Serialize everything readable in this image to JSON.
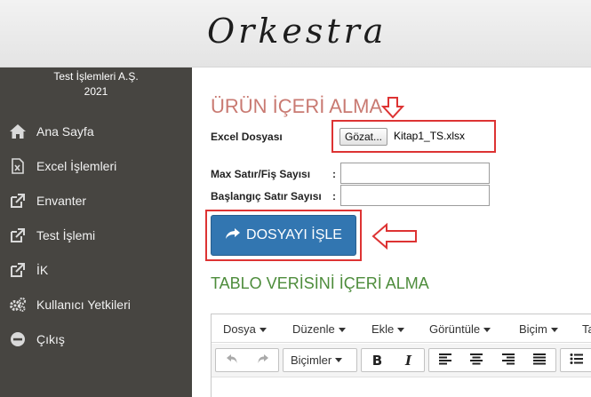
{
  "header": {
    "brand": "Orkestra"
  },
  "sidebar": {
    "company": "Test İşlemleri A.Ş.",
    "year": "2021",
    "items": [
      {
        "label": "Ana Sayfa",
        "icon": "home-icon"
      },
      {
        "label": "Excel İşlemleri",
        "icon": "excel-file-icon"
      },
      {
        "label": "Envanter",
        "icon": "external-link-icon"
      },
      {
        "label": "Test İşlemi",
        "icon": "external-link-icon"
      },
      {
        "label": "İK",
        "icon": "external-link-icon"
      },
      {
        "label": "Kullanıcı Yetkileri",
        "icon": "gears-icon"
      },
      {
        "label": "Çıkış",
        "icon": "minus-circle-icon"
      }
    ]
  },
  "main": {
    "title": "ÜRÜN İÇERİ ALMA",
    "excel_label": "Excel Dosyası",
    "browse_label": "Gözat...",
    "file_name": "Kitap1_TS.xlsx",
    "max_rows_label": "Max Satır/Fiş Sayısı",
    "start_row_label": "Başlangıç Satır Sayısı",
    "colon": ":",
    "max_rows_value": "",
    "start_row_value": "",
    "process_button": "DOSYAYI İŞLE",
    "table_section_title": "TABLO VERİSİNİ İÇERİ ALMA"
  },
  "editor": {
    "menus": [
      "Dosya",
      "Düzenle",
      "Ekle",
      "Görüntüle",
      "Biçim",
      "Ta"
    ],
    "format_select": "Biçimler"
  },
  "colors": {
    "sidebar_bg": "#474541",
    "title_color": "#c97a72",
    "section_title_color": "#4d8c3b",
    "button_blue": "#3276b1",
    "highlight_red": "#d33333"
  }
}
